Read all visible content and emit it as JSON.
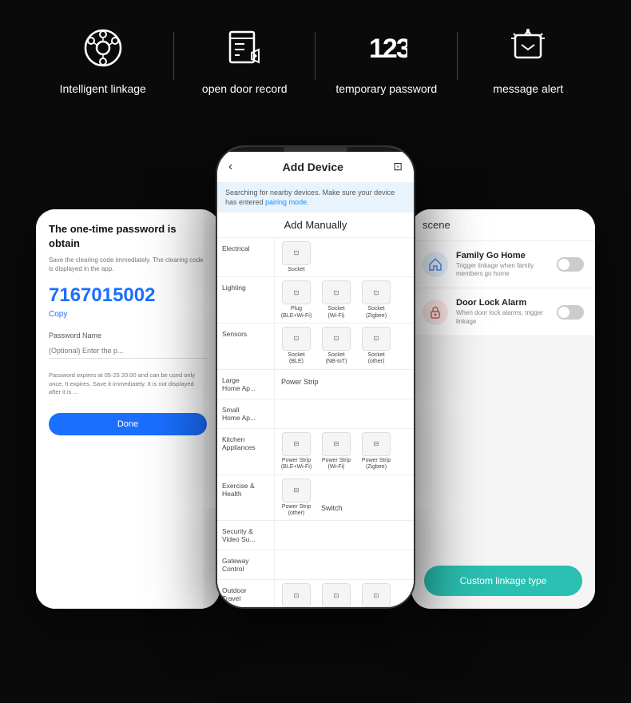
{
  "header": {
    "icons": [
      {
        "id": "intelligent-linkage",
        "symbol": "linkage",
        "label": "Intelligent\nlinkage"
      },
      {
        "id": "open-door-record",
        "symbol": "door",
        "label": "open door\nrecord"
      },
      {
        "id": "temporary-password",
        "symbol": "123",
        "label": "temporary\npassword"
      },
      {
        "id": "message-alert",
        "symbol": "bell",
        "label": "message\nalert"
      }
    ]
  },
  "left_phone": {
    "title": "The one-time password is obtain",
    "subtitle": "Save the clearing code immediately. The clearing code is displayed in the app.",
    "otp_number": "7167015002",
    "copy_label": "Copy",
    "password_name_label": "Password Name",
    "password_name_placeholder": "(Optional) Enter the p...",
    "expires_text": "Password expires at 05-25 20:00 and can be used only once. It expires. Save it immediately. It is not displayed after it is ...",
    "done_label": "Done"
  },
  "center_phone": {
    "header_title": "Add Device",
    "search_text": "Searching for nearby devices. Make sure your device has entered ",
    "pairing_mode_text": "pairing mode.",
    "add_manually_title": "Add Manually",
    "categories": [
      {
        "name": "Electrical",
        "items": [
          {
            "label": "Socket",
            "icon": "⊡"
          }
        ]
      },
      {
        "name": "Lighting",
        "items": [
          {
            "label": "Plug\n(BLE+Wi-Fi)",
            "icon": "⊡"
          },
          {
            "label": "Socket\n(Wi-Fi)",
            "icon": "⊡"
          },
          {
            "label": "Socket\n(Zigbee)",
            "icon": "⊡"
          }
        ]
      },
      {
        "name": "Sensors",
        "items": [
          {
            "label": "Socket\n(BLE)",
            "icon": "⊡"
          },
          {
            "label": "Socket\n(NB-IoT)",
            "icon": "⊡"
          },
          {
            "label": "Socket\n(other)",
            "icon": "⊡"
          }
        ]
      },
      {
        "name": "Large\nHome Ap...",
        "items": [],
        "extra": "Power Strip"
      },
      {
        "name": "Small\nHome Ap...",
        "items": []
      },
      {
        "name": "Kitchen\nAppliances",
        "items": [
          {
            "label": "Power Strip\n(BLE+Wi-Fi)",
            "icon": "⊡"
          },
          {
            "label": "Power Strip\n(Wi-Fi)",
            "icon": "⊡"
          },
          {
            "label": "Power Strip\n(Zigbee)",
            "icon": "⊡"
          }
        ]
      },
      {
        "name": "Exercise &\nHealth",
        "items": [
          {
            "label": "Power Strip\n(other)",
            "icon": "⊡"
          }
        ],
        "extra": "Switch"
      },
      {
        "name": "Security &\nVideo Su...",
        "items": []
      },
      {
        "name": "Gateway\nControl",
        "items": []
      },
      {
        "name": "Outdoor\nTravel",
        "items": []
      }
    ]
  },
  "right_phone": {
    "header_title": "scene",
    "items": [
      {
        "name": "Family Go Home",
        "description": "Trigger linkage when family members go home",
        "icon_type": "home",
        "icon_emoji": "🏠",
        "toggle_on": false
      },
      {
        "name": "Door Lock Alarm",
        "description": "When door lock alarms, trigger linkage",
        "icon_type": "lock",
        "icon_emoji": "🔒",
        "toggle_on": false
      }
    ],
    "custom_linkage_label": "Custom linkage type"
  },
  "colors": {
    "background": "#0a0a0a",
    "accent_blue": "#1a6fff",
    "accent_teal": "#2abfb0",
    "white": "#ffffff",
    "icon_white": "#ffffff"
  }
}
